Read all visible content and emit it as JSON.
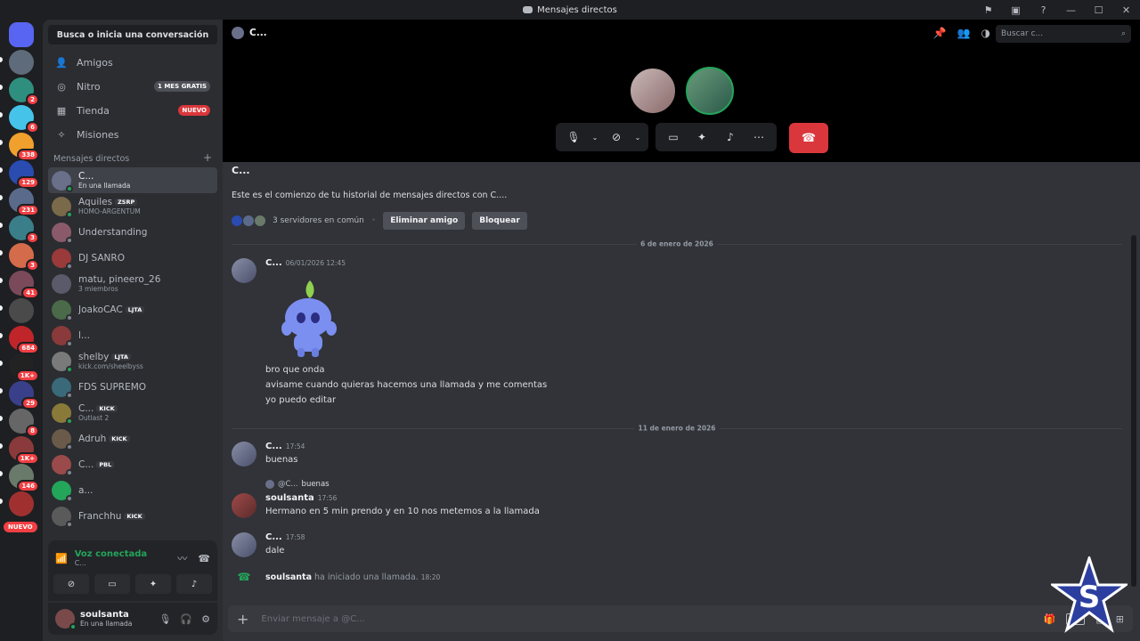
{
  "window": {
    "title": "Mensajes directos"
  },
  "titlebar_icons": [
    "flag-icon",
    "inbox-icon",
    "help-icon",
    "minimize-icon",
    "maximize-icon",
    "close-icon"
  ],
  "guilds": [
    {
      "name": "discord-home",
      "color": "#5865f2",
      "badge": ""
    },
    {
      "name": "guild-1",
      "color": "#5e6b7a",
      "badge": ""
    },
    {
      "name": "guild-2",
      "color": "#2f8f7f",
      "badge": "2"
    },
    {
      "name": "guild-3",
      "color": "#46c3e8",
      "badge": "6"
    },
    {
      "name": "guild-4",
      "color": "#f0a02c",
      "badge": "338"
    },
    {
      "name": "guild-5",
      "color": "#2a4bb0",
      "badge": "129"
    },
    {
      "name": "guild-6",
      "color": "#5a6a8a",
      "badge": "231"
    },
    {
      "name": "guild-7",
      "color": "#3a7e8a",
      "badge": "3"
    },
    {
      "name": "guild-8",
      "color": "#d46b4a",
      "badge": "3"
    },
    {
      "name": "guild-9",
      "color": "#7a4a5a",
      "badge": "41"
    },
    {
      "name": "guild-10",
      "color": "#4a4a4a",
      "badge": ""
    },
    {
      "name": "guild-11",
      "color": "#c0252a",
      "badge": "684"
    },
    {
      "name": "guild-12",
      "color": "#222222",
      "badge": "1K+"
    },
    {
      "name": "guild-13",
      "color": "#3a3f8a",
      "badge": "29"
    },
    {
      "name": "guild-14",
      "color": "#666666",
      "badge": "8"
    },
    {
      "name": "guild-15",
      "color": "#8a3a3a",
      "badge": "1K+"
    },
    {
      "name": "guild-16",
      "color": "#6a7a6a",
      "badge": "146"
    },
    {
      "name": "guild-17",
      "color": "#a03030",
      "badge": ""
    }
  ],
  "nuevo_pill": "NUEVO",
  "sidebar": {
    "search_label": "Busca o inicia una conversación",
    "nav": [
      {
        "label": "Amigos",
        "icon": "friends-icon",
        "tag": ""
      },
      {
        "label": "Nitro",
        "icon": "nitro-icon",
        "tag": "1 MES GRATIS",
        "tag_color": "#4e5058"
      },
      {
        "label": "Tienda",
        "icon": "shop-icon",
        "tag": "NUEVO",
        "tag_color": "#da373c"
      },
      {
        "label": "Misiones",
        "icon": "quests-icon",
        "tag": ""
      }
    ],
    "dm_header": "Mensajes directos",
    "dm_add": "+",
    "dms": [
      {
        "name": "C...",
        "sub": "En una llamada",
        "tag": "",
        "color": "#6a6f8a",
        "status": "#23a55a",
        "active": true
      },
      {
        "name": "Aquiles",
        "sub": "HOMO-ARGENTUM",
        "tag": "ZSRP",
        "color": "#7a6a4a",
        "status": "#23a55a"
      },
      {
        "name": "Understanding",
        "sub": "",
        "tag": "",
        "color": "#8a5a6a",
        "status": "#80848e"
      },
      {
        "name": "DJ SANRO",
        "sub": "",
        "tag": "",
        "color": "#9a3a3a",
        "status": "#80848e"
      },
      {
        "name": "matu, pineero_26",
        "sub": "3 miembros",
        "tag": "",
        "color": "#5a5a6a",
        "status": ""
      },
      {
        "name": "JoakoCAC",
        "sub": "",
        "tag": "LJTA",
        "color": "#4a6a4a",
        "status": "#80848e"
      },
      {
        "name": "l...",
        "sub": "",
        "tag": "",
        "color": "#8a3a3a",
        "status": "#80848e"
      },
      {
        "name": "shelby",
        "sub": "kick.com/sheelbyss",
        "tag": "LJTA",
        "color": "#7a7a7a",
        "status": "#23a55a"
      },
      {
        "name": "FDS SUPREMO",
        "sub": "",
        "tag": "",
        "color": "#3a6a7a",
        "status": "#80848e"
      },
      {
        "name": "C...",
        "sub": "Outlast 2",
        "tag": "KICK",
        "color": "#8a7a3a",
        "status": "#23a55a"
      },
      {
        "name": "Adruh",
        "sub": "",
        "tag": "KICK",
        "color": "#6a5a4a",
        "status": "#80848e"
      },
      {
        "name": "C...",
        "sub": "",
        "tag": "PBL",
        "color": "#9a4a4a",
        "status": "#80848e"
      },
      {
        "name": "a...",
        "sub": "",
        "tag": "",
        "color": "#23a55a",
        "status": "#80848e"
      },
      {
        "name": "Franchhu",
        "sub": "",
        "tag": "KICK",
        "color": "#5a5a5a",
        "status": "#80848e"
      }
    ]
  },
  "voice": {
    "title": "Voz conectada",
    "sub": "C..."
  },
  "user": {
    "name": "soulsanta",
    "status": "En una llamada"
  },
  "header": {
    "channel": "C...",
    "search_placeholder": "Buscar c..."
  },
  "call": {
    "avatar1_color": "#b9a8a8",
    "avatar2_color": "#4a8a6a"
  },
  "chat": {
    "welcome_name": "C...",
    "welcome_text": "Este es el comienzo de tu historial de mensajes directos con C....",
    "common_servers": "3 servidores en común",
    "remove_friend": "Eliminar amigo",
    "block": "Bloquear",
    "date1": "6 de enero de 2026",
    "date2": "11 de enero de 2026",
    "msg1": {
      "author": "C...",
      "time": "06/01/2026 12:45",
      "lines": [
        "bro que onda",
        "avisame cuando quieras hacemos una llamada y me comentas",
        "yo puedo editar"
      ]
    },
    "msg2": {
      "author": "C...",
      "time": "17:54",
      "line": "buenas"
    },
    "reply": {
      "ref_author": "@C...",
      "ref_text": "buenas"
    },
    "msg3": {
      "author": "soulsanta",
      "time": "17:56",
      "line": "Hermano en 5 min prendo y en 10 nos metemos a la llamada"
    },
    "msg4": {
      "author": "C...",
      "time": "17:58",
      "line": "dale"
    },
    "system": {
      "author": "soulsanta",
      "text": "ha iniciado una llamada.",
      "time": "18:20"
    },
    "composer_placeholder": "Enviar mensaje a @C..."
  }
}
